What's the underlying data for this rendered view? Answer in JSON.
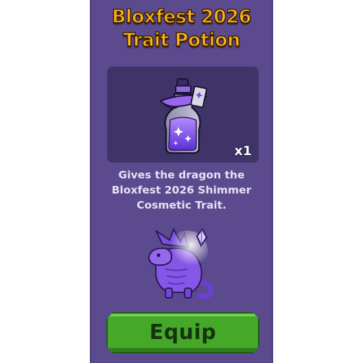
{
  "panel": {
    "title_line1": "Bloxfest 2026",
    "title_line2": "Trait Potion"
  },
  "item": {
    "icon": "potion-icon",
    "quantity": "x1"
  },
  "description": {
    "line1": "Gives the dragon the",
    "line2": "Bloxfest 2026 Shimmer",
    "line3": "Cosmetic Trait."
  },
  "preview": {
    "icon": "dragon-icon"
  },
  "actions": {
    "equip_label": "Equip"
  },
  "colors": {
    "panel": "#5c4a8f",
    "title": "#ffb21a",
    "item_bg": "#3f3468",
    "equip_button": "#46a829"
  }
}
